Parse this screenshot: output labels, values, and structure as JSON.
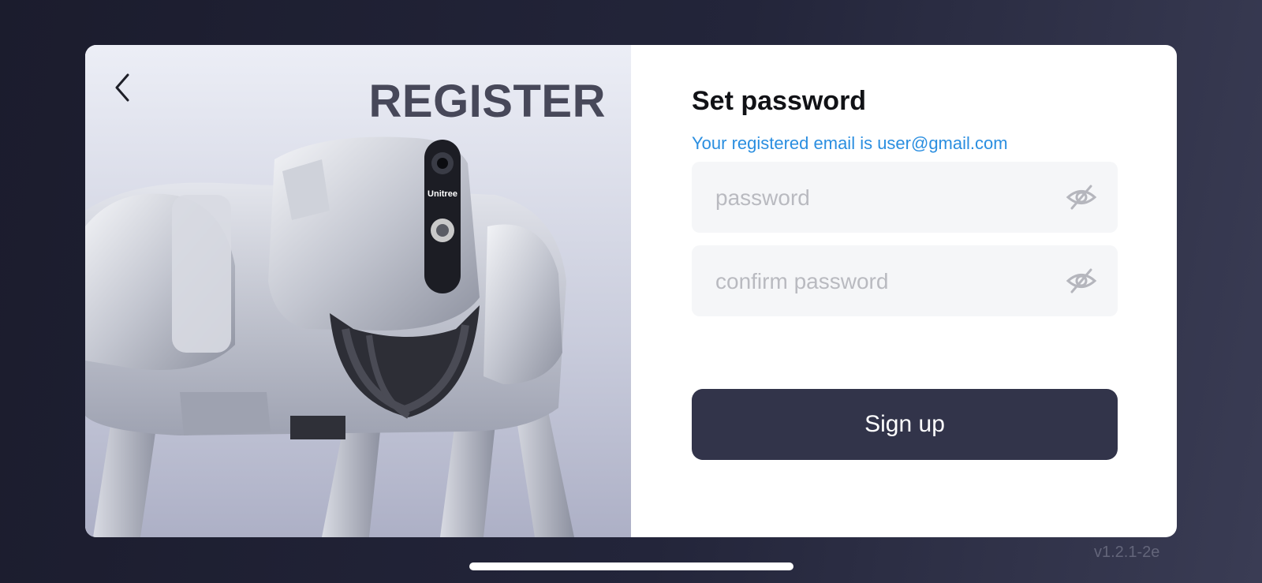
{
  "hero": {
    "title": "REGISTER",
    "brand_label": "Unitree"
  },
  "form": {
    "title": "Set password",
    "subtitle": "Your registered email is user@gmail.com",
    "password_placeholder": "password",
    "confirm_placeholder": "confirm password",
    "signup_label": "Sign up"
  },
  "icons": {
    "back": "chevron-left-icon",
    "password_visibility": "eye-slash-icon",
    "confirm_visibility": "eye-slash-icon"
  },
  "footer": {
    "version": "v1.2.1-2e"
  },
  "colors": {
    "accent": "#2a8ee0",
    "button": "#32344a",
    "title_dark": "#474859",
    "field_bg": "#f5f6f8"
  }
}
